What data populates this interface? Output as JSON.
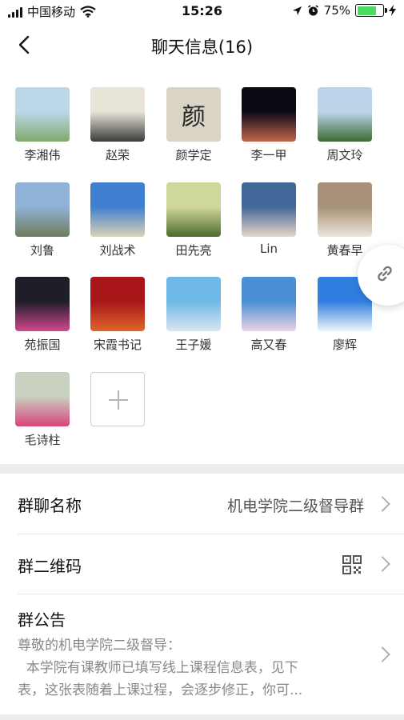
{
  "status_bar": {
    "carrier": "中国移动",
    "time": "15:26",
    "battery_percent": "75%",
    "battery_level": 0.75,
    "battery_color": "#4cd964"
  },
  "nav": {
    "title": "聊天信息(16)",
    "back_icon": "chevron-left-icon"
  },
  "members": [
    {
      "name": "李湘伟",
      "colors": [
        "#bcd7e8",
        "#7fa86b"
      ]
    },
    {
      "name": "赵荣",
      "colors": [
        "#e8e4d8",
        "#3a3a3a"
      ]
    },
    {
      "name": "颜学定",
      "avatar_text": "颜",
      "colors": [
        "#d9d4c5",
        "#b8ae92"
      ]
    },
    {
      "name": "李一甲",
      "colors": [
        "#0a0a14",
        "#c2664d"
      ]
    },
    {
      "name": "周文玲",
      "colors": [
        "#bcd4ea",
        "#3d6a34"
      ]
    },
    {
      "name": "刘鲁",
      "colors": [
        "#8fb2d6",
        "#6f7b5a"
      ]
    },
    {
      "name": "刘战术",
      "colors": [
        "#3f7fd0",
        "#d9d3b5"
      ]
    },
    {
      "name": "田先亮",
      "colors": [
        "#cfd89a",
        "#4d6a2d"
      ]
    },
    {
      "name": "Lin",
      "colors": [
        "#42689a",
        "#e8d6c8"
      ]
    },
    {
      "name": "黄春早",
      "colors": [
        "#a89178",
        "#ece6dc"
      ]
    },
    {
      "name": "苑振国",
      "colors": [
        "#1e1e28",
        "#d2478f"
      ]
    },
    {
      "name": "宋霞书记",
      "colors": [
        "#a8161a",
        "#e0662a"
      ]
    },
    {
      "name": "王子媛",
      "colors": [
        "#6fb9e8",
        "#d9e6f0"
      ]
    },
    {
      "name": "高又春",
      "colors": [
        "#4a8ed6",
        "#ecd4e2"
      ]
    },
    {
      "name": "廖辉",
      "colors": [
        "#2f7fe0",
        "#f0f4fa"
      ]
    },
    {
      "name": "毛诗柱",
      "colors": [
        "#c8d0c0",
        "#d8447c"
      ]
    }
  ],
  "add_member_icon": "plus-icon",
  "link_bubble_icon": "link-icon",
  "settings": {
    "group_name_label": "群聊名称",
    "group_name_value": "机电学院二级督导群",
    "qr_label": "群二维码",
    "qr_icon": "qr-code-icon",
    "notice_label": "群公告",
    "notice_lines": [
      "尊敬的机电学院二级督导：",
      "  本学院有课教师已填写线上课程信息表，见下",
      "表，这张表随着上课过程，会逐步修正，你可..."
    ]
  }
}
